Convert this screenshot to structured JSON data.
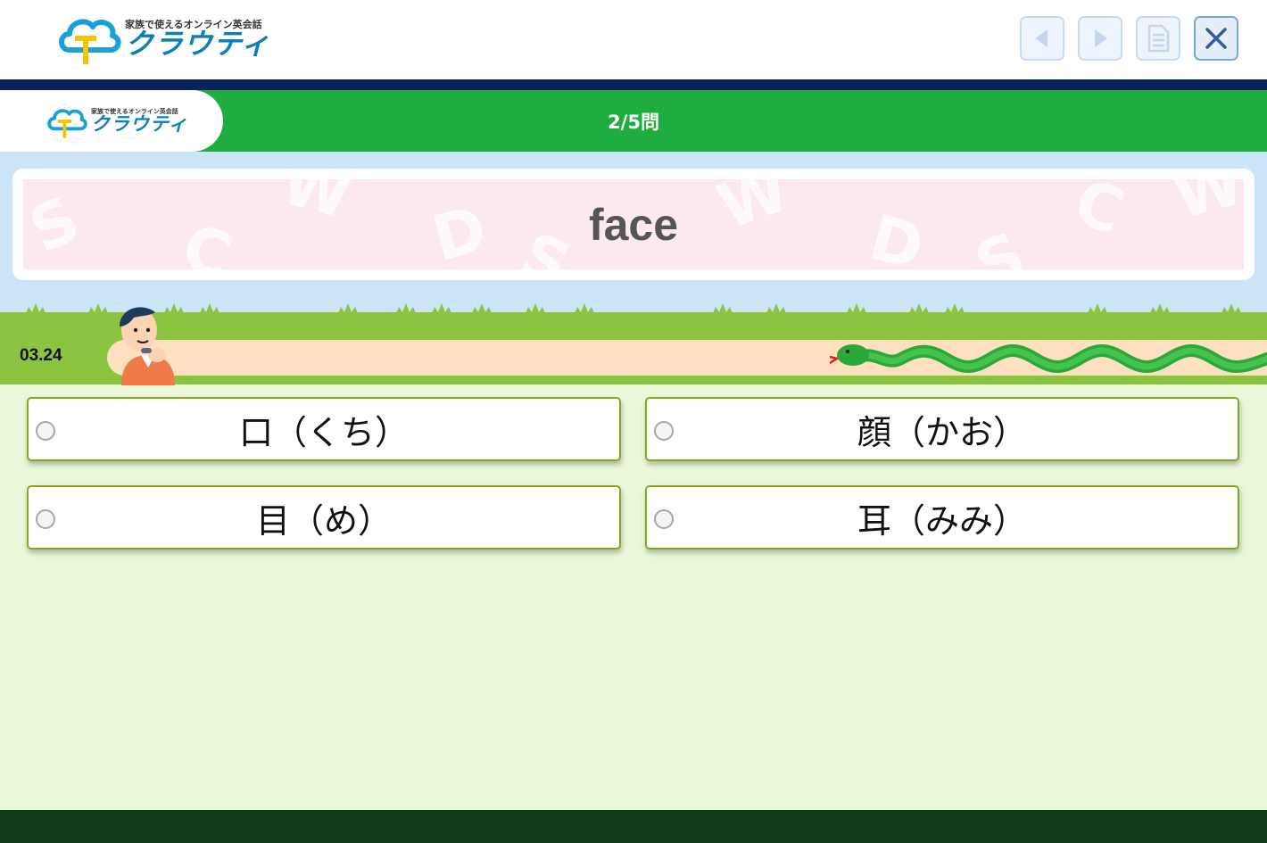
{
  "header": {
    "logo_tagline": "家族で使えるオンライン英会話",
    "logo_name": "クラウティ",
    "buttons": [
      "back-icon",
      "forward-icon",
      "document-icon",
      "close-icon"
    ]
  },
  "quiz_bar": {
    "logo_tagline": "家族で使えるオンライン英会話",
    "logo_name": "クラウティ",
    "progress": "2/5問"
  },
  "question": {
    "word": "face"
  },
  "timer": {
    "value": "03.24"
  },
  "choices": [
    {
      "label": "口（くち）"
    },
    {
      "label": "顔（かお）"
    },
    {
      "label": "目（め）"
    },
    {
      "label": "耳（みみ）"
    }
  ],
  "colors": {
    "header_bg": "#ffffff",
    "navy_strip": "#0b1f5c",
    "quiz_bar": "#1fad3f",
    "sky": "#cce4f8",
    "grass": "#8cc43f",
    "track": "#fde0c0",
    "answer_area": "#e8f8d9",
    "choice_border": "#8aa61f",
    "footer": "#0c3d16"
  }
}
